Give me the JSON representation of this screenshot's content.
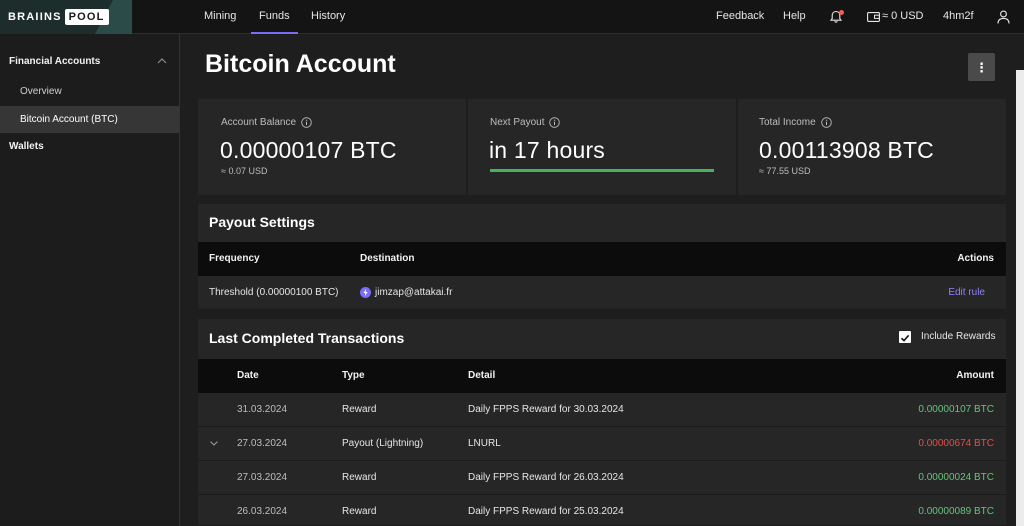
{
  "logo": {
    "brains": "BRAIINS",
    "pool": "POOL"
  },
  "nav": {
    "mining": "Mining",
    "funds": "Funds",
    "history": "History",
    "feedback": "Feedback",
    "help": "Help",
    "wallet_balance": "≈ 0 USD",
    "username": "4hm2f"
  },
  "sidebar": {
    "financial_accounts": "Financial Accounts",
    "overview": "Overview",
    "bitcoin_account": "Bitcoin Account (BTC)",
    "wallets": "Wallets"
  },
  "page": {
    "title": "Bitcoin Account",
    "more": "⋮"
  },
  "cards": [
    {
      "label": "Account Balance",
      "value": "0.00000107 BTC",
      "sub": "≈ 0.07 USD"
    },
    {
      "label": "Next Payout",
      "value": "in 17 hours",
      "progress": 1.0
    },
    {
      "label": "Total Income",
      "value": "0.00113908 BTC",
      "sub": "≈ 77.55 USD"
    }
  ],
  "payout": {
    "title": "Payout Settings",
    "headers": {
      "frequency": "Frequency",
      "destination": "Destination",
      "actions": "Actions"
    },
    "row": {
      "frequency": "Threshold (0.00000100 BTC)",
      "destination": "jimzap@attakai.fr",
      "action": "Edit rule"
    }
  },
  "transactions": {
    "title": "Last Completed Transactions",
    "include_rewards": "Include Rewards",
    "include_rewards_checked": true,
    "headers": {
      "date": "Date",
      "type": "Type",
      "detail": "Detail",
      "amount": "Amount"
    },
    "rows": [
      {
        "date": "31.03.2024",
        "type": "Reward",
        "detail": "Daily FPPS Reward for 30.03.2024",
        "amount": "0.00000107 BTC",
        "sign": "positive"
      },
      {
        "date": "27.03.2024",
        "type": "Payout (Lightning)",
        "detail": "LNURL",
        "amount": "0.00000674 BTC",
        "sign": "negative",
        "expandable": true
      },
      {
        "date": "27.03.2024",
        "type": "Reward",
        "detail": "Daily FPPS Reward for 26.03.2024",
        "amount": "0.00000024 BTC",
        "sign": "positive"
      },
      {
        "date": "26.03.2024",
        "type": "Reward",
        "detail": "Daily FPPS Reward for 25.03.2024",
        "amount": "0.00000089 BTC",
        "sign": "positive"
      }
    ]
  },
  "colors": {
    "accent": "#7a6cf7",
    "positive": "#68c47a",
    "negative": "#e0504a",
    "progress": "#46b35c"
  }
}
